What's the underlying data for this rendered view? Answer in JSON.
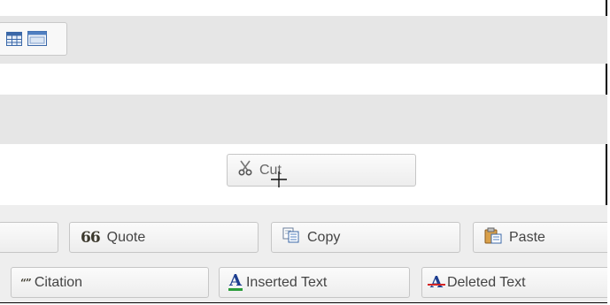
{
  "toolbar": {
    "icons": [
      "table-icon",
      "layout-icon"
    ],
    "buttons": {
      "cut": "Cut",
      "quote": "Quote",
      "copy": "Copy",
      "paste": "Paste",
      "citation": "Citation",
      "inserted": "Inserted Text",
      "deleted": "Deleted Text"
    },
    "icon_names": {
      "cut": "scissors-icon",
      "quote": "quote-icon",
      "copy": "copy-icon",
      "paste": "paste-icon",
      "citation": "citation-icon",
      "inserted": "inserted-text-icon",
      "deleted": "deleted-text-icon"
    }
  },
  "colors": {
    "band": "#e6e6e6",
    "button_border": "#c6c6c6",
    "text": "#444444"
  }
}
